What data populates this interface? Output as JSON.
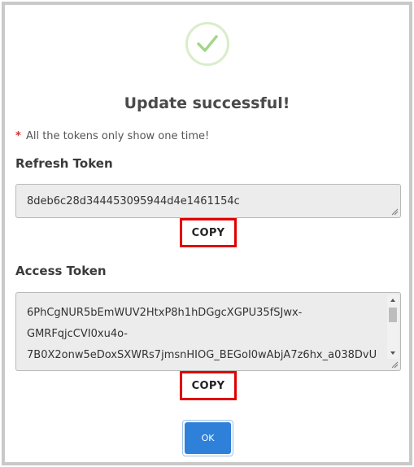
{
  "dialog": {
    "title": "Update successful!",
    "note_marker": "*",
    "note": "All the tokens only show one time!"
  },
  "refresh_token": {
    "label": "Refresh Token",
    "value": "8deb6c28d344453095944d4e1461154c",
    "copy_label": "COPY"
  },
  "access_token": {
    "label": "Access Token",
    "lines": [
      "6PhCgNUR5bEmWUV2HtxP8h1hDGgcXGPU35fSJwx-",
      "GMRFqjcCVI0xu4o-",
      "7B0X2onw5eDoxSXWRs7jmsnHIOG_BEGoI0wAbjA7z6hx_a038DvU"
    ],
    "copy_label": "COPY"
  },
  "footer": {
    "ok_label": "OK"
  },
  "colors": {
    "success_check": "#a5d68a",
    "highlight_border": "#e00000",
    "primary_button": "#2f80d8"
  },
  "icons": {
    "success": "checkmark-icon",
    "required": "asterisk",
    "resize": "resize-grip-icon"
  }
}
